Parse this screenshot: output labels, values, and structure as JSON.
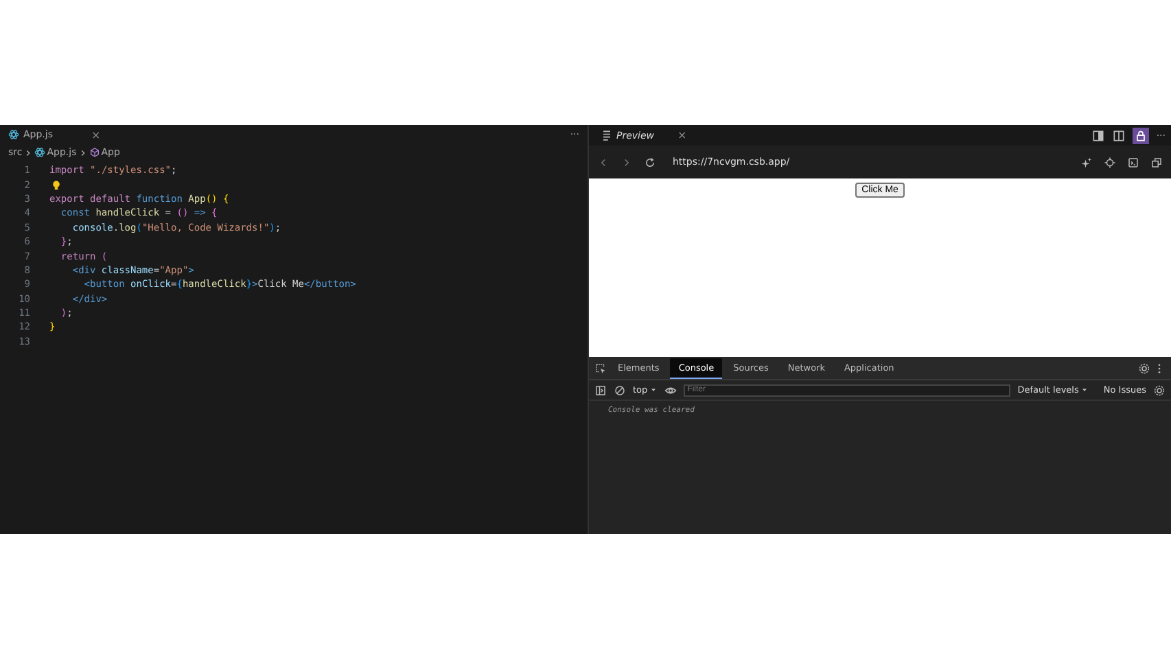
{
  "editor": {
    "tab": {
      "label": "App.js",
      "close": "×",
      "more": "···"
    },
    "breadcrumb": [
      "src",
      "App.js",
      "App"
    ],
    "lines": [
      {
        "number": "1",
        "lightbulb": false,
        "tokens": [
          {
            "text": "import ",
            "kind": "keyword"
          },
          {
            "text": "\"./styles.css\"",
            "kind": "string"
          },
          {
            "text": ";",
            "kind": "plain"
          }
        ]
      },
      {
        "number": "2",
        "lightbulb": true
      },
      {
        "number": "3",
        "lightbulb": false,
        "tokens": [
          {
            "text": "export default ",
            "kind": "keyword"
          },
          {
            "text": "function ",
            "kind": "storage"
          },
          {
            "text": "App",
            "kind": "func"
          },
          {
            "text": "() {",
            "kind": "bracket1"
          }
        ]
      },
      {
        "number": "4",
        "lightbulb": false,
        "tokens": [
          {
            "text": "  const ",
            "kind": "storage"
          },
          {
            "text": "handleClick",
            "kind": "func"
          },
          {
            "text": " = ",
            "kind": "plain"
          },
          {
            "text": "()",
            "kind": "bracket2"
          },
          {
            "text": " => ",
            "kind": "storage"
          },
          {
            "text": "{",
            "kind": "bracket2"
          }
        ]
      },
      {
        "number": "5",
        "lightbulb": false,
        "tokens": [
          {
            "text": "    console",
            "kind": "var"
          },
          {
            "text": ".",
            "kind": "plain"
          },
          {
            "text": "log",
            "kind": "func"
          },
          {
            "text": "(",
            "kind": "bracket3"
          },
          {
            "text": "\"Hello, Code Wizards!\"",
            "kind": "string"
          },
          {
            "text": ")",
            "kind": "bracket3"
          },
          {
            "text": ";",
            "kind": "plain"
          }
        ]
      },
      {
        "number": "6",
        "lightbulb": false,
        "tokens": [
          {
            "text": "  }",
            "kind": "bracket2"
          },
          {
            "text": ";",
            "kind": "plain"
          }
        ]
      },
      {
        "number": "7",
        "lightbulb": false,
        "tokens": [
          {
            "text": "  return",
            "kind": "keyword"
          },
          {
            "text": " (",
            "kind": "bracket2"
          }
        ]
      },
      {
        "number": "8",
        "lightbulb": false,
        "tokens": [
          {
            "text": "    <div",
            "kind": "tag"
          },
          {
            "text": " className",
            "kind": "attr"
          },
          {
            "text": "=",
            "kind": "plain"
          },
          {
            "text": "\"App\"",
            "kind": "string"
          },
          {
            "text": ">",
            "kind": "tag"
          }
        ]
      },
      {
        "number": "9",
        "lightbulb": false,
        "tokens": [
          {
            "text": "      <button",
            "kind": "tag"
          },
          {
            "text": " onClick",
            "kind": "attr"
          },
          {
            "text": "=",
            "kind": "plain"
          },
          {
            "text": "{",
            "kind": "bracket3"
          },
          {
            "text": "handleClick",
            "kind": "func"
          },
          {
            "text": "}",
            "kind": "bracket3"
          },
          {
            "text": ">",
            "kind": "tag"
          },
          {
            "text": "Click Me",
            "kind": "plain"
          },
          {
            "text": "</button>",
            "kind": "tag"
          }
        ]
      },
      {
        "number": "10",
        "lightbulb": false,
        "tokens": [
          {
            "text": "    </div>",
            "kind": "tag"
          }
        ]
      },
      {
        "number": "11",
        "lightbulb": false,
        "tokens": [
          {
            "text": "  )",
            "kind": "bracket2"
          },
          {
            "text": ";",
            "kind": "plain"
          }
        ]
      },
      {
        "number": "12",
        "lightbulb": false,
        "tokens": [
          {
            "text": "}",
            "kind": "bracket1"
          }
        ]
      },
      {
        "number": "13",
        "lightbulb": false
      }
    ]
  },
  "preview": {
    "tab": {
      "label": "Preview",
      "close": "×",
      "more": "···"
    },
    "lock_selected": true,
    "url": "https://7ncvgm.csb.app/",
    "page_button": "Click Me",
    "devtools": {
      "tabs": [
        {
          "label": "Elements",
          "selected": false
        },
        {
          "label": "Console",
          "selected": true
        },
        {
          "label": "Sources",
          "selected": false
        },
        {
          "label": "Network",
          "selected": false
        },
        {
          "label": "Application",
          "selected": false
        }
      ],
      "context": "top",
      "filter_placeholder": "Filter",
      "levels": "Default levels",
      "issues": "No Issues",
      "messages": [
        "Console was cleared"
      ]
    }
  }
}
